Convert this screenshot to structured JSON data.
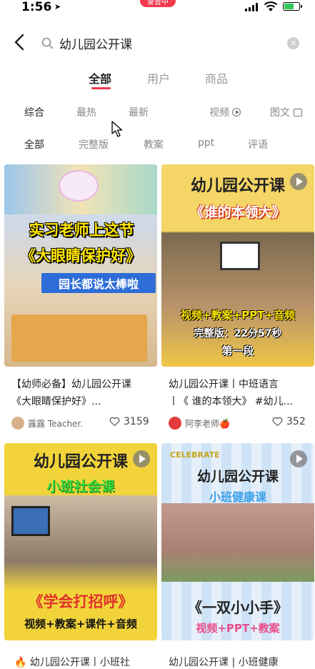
{
  "status_bar": {
    "time": "1:56",
    "pill_label": "录音中"
  },
  "search": {
    "query": "幼儿园公开课"
  },
  "tabs": [
    {
      "label": "全部"
    },
    {
      "label": "用户"
    },
    {
      "label": "商品"
    }
  ],
  "sort_options": [
    {
      "label": "综合"
    },
    {
      "label": "最热"
    },
    {
      "label": "最新"
    },
    {
      "label": "视频"
    },
    {
      "label": "图文"
    }
  ],
  "filters": [
    {
      "label": "全部"
    },
    {
      "label": "完整版"
    },
    {
      "label": "教案"
    },
    {
      "label": "ppt"
    },
    {
      "label": "评语"
    }
  ],
  "cards": [
    {
      "thumb_line1": "实习老师上这节",
      "thumb_line2": "《大眼睛保护好》",
      "thumb_line3": "园长都说太棒啦",
      "title_line1": "【幼师必备】幼儿园公开课",
      "title_line2": "《大眼睛保护好》...",
      "author": "露露 Teacher.",
      "likes": "3159"
    },
    {
      "thumb_line1": "幼儿园公开课",
      "thumb_line2": "《谁的本领大》",
      "thumb_line3": "视频+教案+PPT+音频",
      "thumb_line4": "完整版：22分57秒",
      "thumb_line5": "第一段",
      "title_line1": "幼儿园公开课丨中班语言",
      "title_line2": "丨《 谁的本领大》 #幼儿...",
      "author": "阿李老师🍎",
      "likes": "352"
    },
    {
      "thumb_line1": "幼儿园公开课",
      "thumb_line2": "小班社会课",
      "thumb_line3": "《学会打招呼》",
      "thumb_line4": "视频+教案+课件+音频"
    },
    {
      "thumb_badge": "CELEBRATE",
      "thumb_line1": "幼儿园公开课",
      "thumb_line2": "小班健康课",
      "thumb_line3": "《一双小小手》",
      "thumb_line4": "视频+PPT+教案"
    }
  ],
  "bottom_bar": {
    "left": "🔥 幼儿园公开课丨小班社",
    "right": "幼儿园公开课 | 小班健康"
  },
  "colors": {
    "accent": "#f1394c",
    "yellow_text": "#ffe600",
    "green_text": "#3cdc3c"
  }
}
